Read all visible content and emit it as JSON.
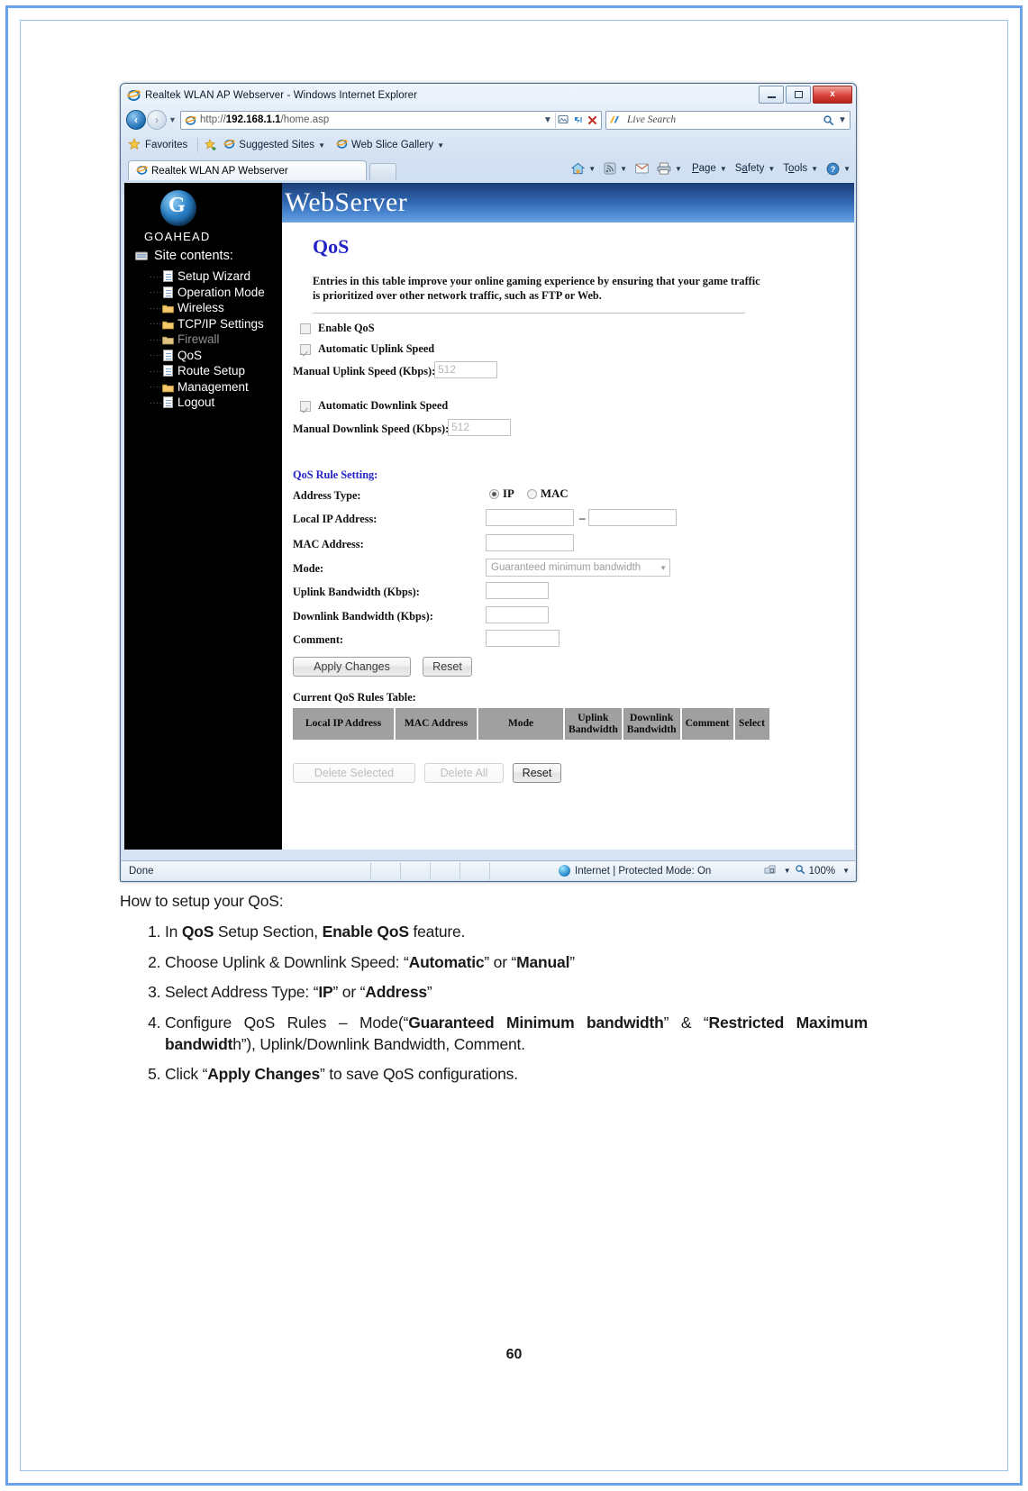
{
  "browser": {
    "title": "Realtek WLAN AP Webserver - Windows Internet Explorer",
    "url_prefix": "http://",
    "url_host": "192.168.1.1",
    "url_path": "/home.asp",
    "search_placeholder": "Live Search",
    "window_buttons": {
      "minimize": "–",
      "maximize": "□",
      "close": "x"
    },
    "favorites_bar": {
      "favorites_label": "Favorites",
      "suggested_sites": "Suggested Sites",
      "web_slice_gallery": "Web Slice Gallery"
    },
    "tab_label": "Realtek WLAN AP Webserver",
    "command_bar": [
      "Page",
      "Safety",
      "Tools"
    ],
    "status_bar": {
      "status": "Done",
      "zone": "Internet | Protected Mode: On",
      "zoom": "100%"
    }
  },
  "webserver": {
    "banner_title": "WebServer",
    "brand": "GOAHEAD",
    "site_contents_label": "Site contents:",
    "nav_items": [
      {
        "label": "Setup Wizard",
        "icon": "page-icon",
        "active": false
      },
      {
        "label": "Operation Mode",
        "icon": "page-icon",
        "active": false
      },
      {
        "label": "Wireless",
        "icon": "folder-icon",
        "active": false
      },
      {
        "label": "TCP/IP Settings",
        "icon": "folder-icon",
        "active": false
      },
      {
        "label": "Firewall",
        "icon": "folder-icon",
        "active": true
      },
      {
        "label": "QoS",
        "icon": "page-icon",
        "active": false
      },
      {
        "label": "Route Setup",
        "icon": "page-icon",
        "active": false
      },
      {
        "label": "Management",
        "icon": "folder-icon",
        "active": false
      },
      {
        "label": "Logout",
        "icon": "page-icon",
        "active": false
      }
    ]
  },
  "qos_page": {
    "heading": "QoS",
    "description": "Entries in this table improve your online gaming experience by ensuring that your game traffic is prioritized over other network traffic, such as FTP or Web.",
    "enable_qos_label": "Enable QoS",
    "enable_qos_checked": false,
    "auto_uplink_label": "Automatic Uplink Speed",
    "auto_uplink_checked": true,
    "manual_uplink_label": "Manual Uplink Speed (Kbps):",
    "manual_uplink_value": "512",
    "auto_downlink_label": "Automatic Downlink Speed",
    "auto_downlink_checked": true,
    "manual_downlink_label": "Manual Downlink Speed (Kbps):",
    "manual_downlink_value": "512",
    "rule_setting_heading": "QoS Rule Setting:",
    "address_type_label": "Address Type:",
    "address_type_options": [
      "IP",
      "MAC"
    ],
    "address_type_selected": "IP",
    "local_ip_label": "Local IP Address:",
    "local_ip_start": "",
    "local_ip_end": "",
    "local_ip_separator": "–",
    "mac_address_label": "MAC Address:",
    "mac_address_value": "",
    "mode_label": "Mode:",
    "mode_value": "Guaranteed minimum bandwidth",
    "uplink_bw_label": "Uplink Bandwidth (Kbps):",
    "uplink_bw_value": "",
    "downlink_bw_label": "Downlink Bandwidth (Kbps):",
    "downlink_bw_value": "",
    "comment_label": "Comment:",
    "comment_value": "",
    "apply_button": "Apply Changes",
    "reset_button": "Reset",
    "table_caption": "Current QoS Rules Table:",
    "table_headers": [
      "Local IP Address",
      "MAC Address",
      "Mode",
      "Uplink Bandwidth",
      "Downlink Bandwidth",
      "Comment",
      "Select"
    ],
    "table_rows": [],
    "delete_selected_button": "Delete Selected",
    "delete_all_button": "Delete All",
    "reset_bottom_button": "Reset"
  },
  "document": {
    "intro": "How to setup your QoS:",
    "steps": [
      {
        "parts": [
          {
            "t": "In ",
            "b": false
          },
          {
            "t": "QoS",
            "b": true
          },
          {
            "t": " Setup Section, ",
            "b": false
          },
          {
            "t": "Enable QoS",
            "b": true
          },
          {
            "t": " feature.",
            "b": false
          }
        ]
      },
      {
        "parts": [
          {
            "t": "Choose Uplink & Downlink Speed: “",
            "b": false
          },
          {
            "t": "Automatic",
            "b": true
          },
          {
            "t": "” or “",
            "b": false
          },
          {
            "t": "Manual",
            "b": true
          },
          {
            "t": "”",
            "b": false
          }
        ]
      },
      {
        "parts": [
          {
            "t": "Select Address Type: “",
            "b": false
          },
          {
            "t": "IP",
            "b": true
          },
          {
            "t": "” or “",
            "b": false
          },
          {
            "t": "Address",
            "b": true
          },
          {
            "t": "”",
            "b": false
          }
        ]
      },
      {
        "justify": true,
        "parts": [
          {
            "t": "Configure QoS Rules – Mode(“",
            "b": false
          },
          {
            "t": "Guaranteed Minimum bandwidth",
            "b": true
          },
          {
            "t": "” & “",
            "b": false
          },
          {
            "t": "Restricted Maximum bandwidt",
            "b": true
          },
          {
            "t": "h”), Uplink/Downlink Bandwidth, Comment.",
            "b": false
          }
        ]
      },
      {
        "parts": [
          {
            "t": "Click “",
            "b": false
          },
          {
            "t": "Apply Changes",
            "b": true
          },
          {
            "t": "” to save QoS configurations.",
            "b": false
          }
        ]
      }
    ],
    "page_number": "60"
  },
  "colors": {
    "brand_blue": "#2323c8",
    "banner_blue": "#2f64ad",
    "sidebar_black": "#000000",
    "table_header_gray": "#a0a0a0",
    "page_border_blue": "#6aa3e8"
  }
}
